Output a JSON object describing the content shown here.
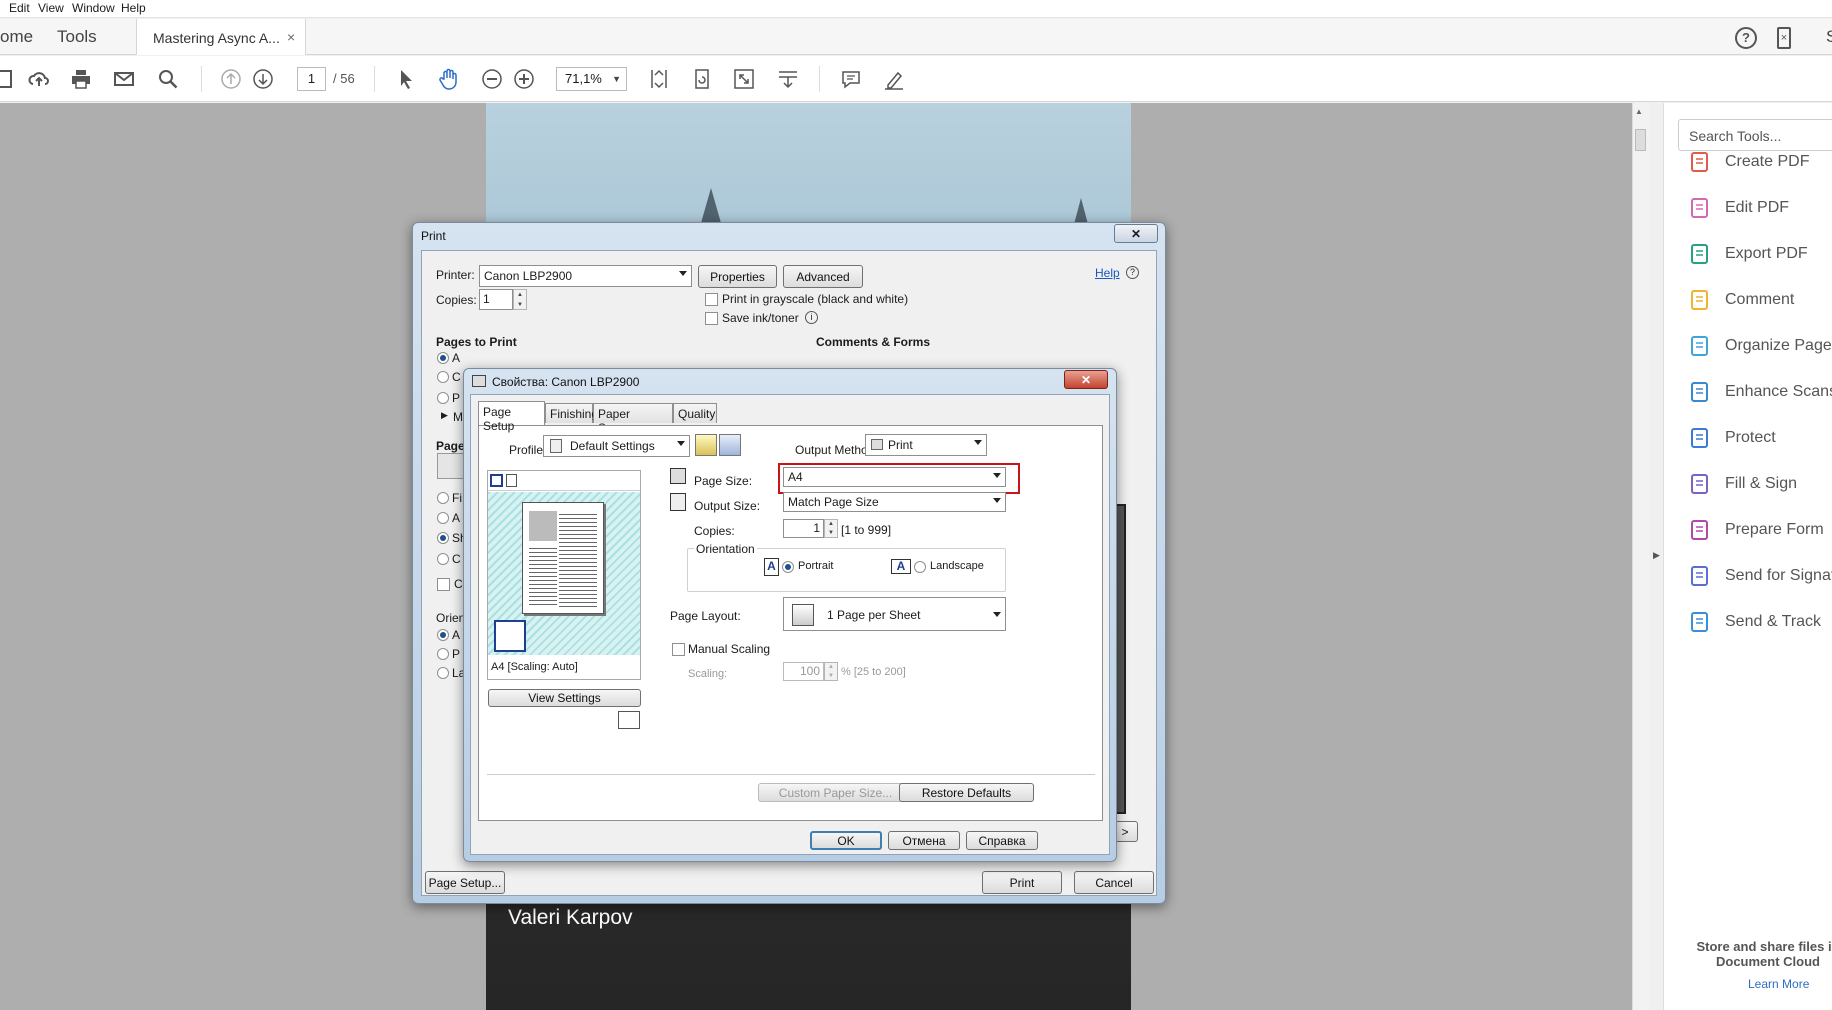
{
  "menu": {
    "items": [
      "Edit",
      "View",
      "Window",
      "Help"
    ]
  },
  "tabs": {
    "home": "ome",
    "tools": "Tools",
    "document": "Mastering Async A...",
    "close": "×",
    "right_letter": "S"
  },
  "toolbar": {
    "page_current": "1",
    "page_total": "/ 56",
    "zoom": "71,1%"
  },
  "document": {
    "author": "Valeri Karpov"
  },
  "tools_pane": {
    "search_placeholder": "Search Tools...",
    "items": [
      {
        "label": "Create PDF",
        "icon": "create-pdf-icon",
        "color": "#e15a4c"
      },
      {
        "label": "Edit PDF",
        "icon": "edit-pdf-icon",
        "color": "#d06bb3"
      },
      {
        "label": "Export PDF",
        "icon": "export-pdf-icon",
        "color": "#2aa082"
      },
      {
        "label": "Comment",
        "icon": "comment-icon",
        "color": "#f0b42d"
      },
      {
        "label": "Organize Pages",
        "icon": "organize-pages-icon",
        "color": "#41a3d9"
      },
      {
        "label": "Enhance Scans",
        "icon": "enhance-scans-icon",
        "color": "#3a89d0"
      },
      {
        "label": "Protect",
        "icon": "protect-icon",
        "color": "#3b7bd4"
      },
      {
        "label": "Fill & Sign",
        "icon": "fill-sign-icon",
        "color": "#7a62c9"
      },
      {
        "label": "Prepare Form",
        "icon": "prepare-form-icon",
        "color": "#b04aa8"
      },
      {
        "label": "Send for Signature",
        "icon": "send-signature-icon",
        "color": "#5b6fd0"
      },
      {
        "label": "Send & Track",
        "icon": "send-track-icon",
        "color": "#3a8fd6"
      }
    ],
    "store_text": "Store and share files in Document Cloud",
    "learn_more": "Learn More"
  },
  "print_dialog": {
    "title": "Print",
    "close": "✕",
    "printer_label": "Printer:",
    "printer_value": "Canon LBP2900",
    "properties_button": "Properties",
    "advanced_button": "Advanced",
    "help_link": "Help",
    "copies_label": "Copies:",
    "copies_value": "1",
    "grayscale_label": "Print in grayscale (black and white)",
    "save_ink_label": "Save ink/toner",
    "pages_to_print": "Pages to Print",
    "comments_forms": "Comments & Forms",
    "page_sizing": "Page",
    "orientation": "Orien",
    "page_setup_button": "Page Setup...",
    "print_button": "Print",
    "cancel_button": "Cancel",
    "partial_radios": [
      "A",
      "C",
      "P",
      "M"
    ],
    "partial_sizing": [
      "Fi",
      "A",
      "Sh",
      "C",
      "C"
    ],
    "partial_orient": [
      "A",
      "P",
      "La"
    ]
  },
  "props_dialog": {
    "title": "Свойства: Canon LBP2900",
    "close": "✕",
    "tabs": [
      "Page Setup",
      "Finishing",
      "Paper Source",
      "Quality"
    ],
    "profile_label": "Profile:",
    "profile_value": "Default Settings",
    "output_method_label": "Output Method:",
    "output_method_value": "Print",
    "page_size_label": "Page Size:",
    "page_size_value": "A4",
    "output_size_label": "Output Size:",
    "output_size_value": "Match Page Size",
    "copies_label": "Copies:",
    "copies_value": "1",
    "copies_range": "[1 to 999]",
    "orientation_label": "Orientation",
    "portrait": "Portrait",
    "landscape": "Landscape",
    "page_layout_label": "Page Layout:",
    "page_layout_value": "1 Page per Sheet",
    "manual_scaling": "Manual Scaling",
    "scaling_label": "Scaling:",
    "scaling_value": "100",
    "scaling_range": "% [25 to 200]",
    "preview_caption": "A4 [Scaling: Auto]",
    "view_settings": "View Settings",
    "custom_paper": "Custom Paper Size...",
    "restore_defaults": "Restore Defaults",
    "ok": "OK",
    "cancel": "Отмена",
    "help": "Справка"
  },
  "colors": {
    "highlight": "#c8151b",
    "link": "#1a56c0"
  }
}
